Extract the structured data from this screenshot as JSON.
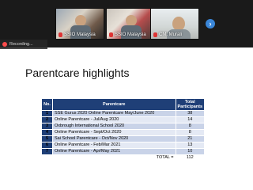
{
  "participants": [
    {
      "name": "SSIO Malaysia"
    },
    {
      "name": "SSIO Malaysia"
    },
    {
      "name": "CM. Murali"
    }
  ],
  "recording": {
    "label": "Recording..."
  },
  "slide": {
    "title": "Parentcare highlights",
    "table": {
      "headers": {
        "no": "No.",
        "name": "Parentcare",
        "total": "Total Participants"
      },
      "rows": [
        {
          "no": "1",
          "name": "SSE Gurus 2020 Online Parentcare May/June 2020",
          "total": "38"
        },
        {
          "no": "2",
          "name": "Online Parentcare - Jul/Aug 2020",
          "total": "14"
        },
        {
          "no": "3",
          "name": "Oxbrough International School 2020",
          "total": "8"
        },
        {
          "no": "4",
          "name": "Online Parentcare - Sept/Oct 2020",
          "total": "8"
        },
        {
          "no": "5",
          "name": "Sai School Parentcare - Oct/Nov 2020",
          "total": "21"
        },
        {
          "no": "6",
          "name": "Online Parentcare - Feb/Mar 2021",
          "total": "13"
        },
        {
          "no": "7",
          "name": "Online Parentcare - Apr/May 2021",
          "total": "10"
        }
      ],
      "total_label": "TOTAL =",
      "total_value": "112"
    }
  },
  "colors": {
    "header": "#1f3f77",
    "row_odd": "#c9d3e8",
    "row_even": "#e4e9f4"
  },
  "icons": {
    "mic": "mic-muted-icon",
    "next": "chevron-right-icon",
    "recording": "record-icon"
  }
}
